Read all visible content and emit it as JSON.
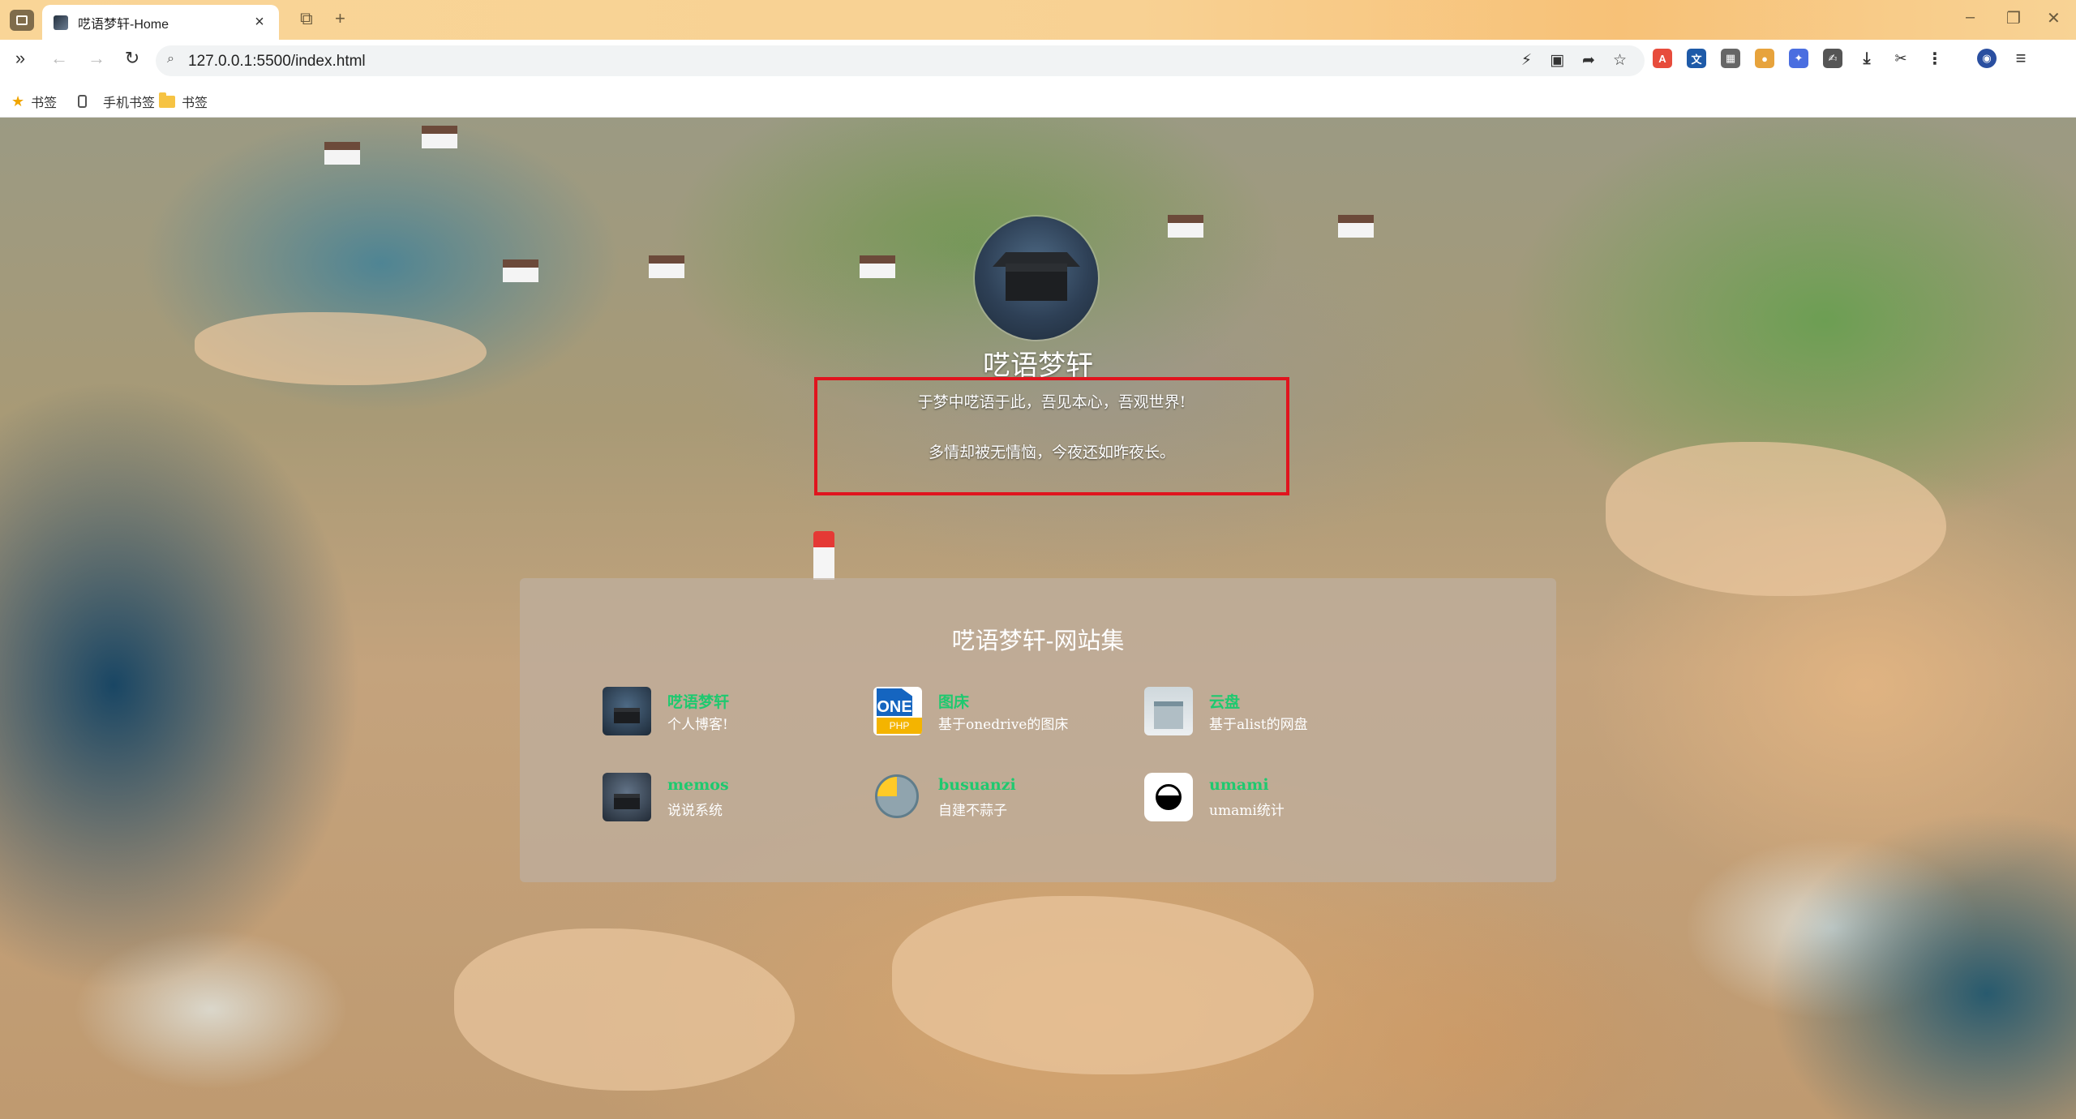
{
  "browser": {
    "tab_title": "呓语梦轩-Home",
    "url": "127.0.0.1:5500/index.html",
    "bookmarks": [
      {
        "label": "书签",
        "icon": "star-icon"
      },
      {
        "label": "手机书签",
        "icon": "phone-icon"
      },
      {
        "label": "书签",
        "icon": "folder-icon"
      }
    ]
  },
  "header": {
    "site_title": "呓语梦轩",
    "motto_line1": "于梦中呓语于此，吾见本心，吾观世界!",
    "motto_line2": "多情却被无情恼，今夜还如昨夜长。"
  },
  "sites": {
    "title": "呓语梦轩-网站集",
    "items": [
      {
        "name": "呓语梦轩",
        "desc": "个人博客!",
        "icon": "blog-icon"
      },
      {
        "name": "图床",
        "desc": "基于onedrive的图床",
        "icon": "onedrive-icon"
      },
      {
        "name": "云盘",
        "desc": "基于alist的网盘",
        "icon": "cloud-icon"
      },
      {
        "name": "memos",
        "desc": "说说系统",
        "icon": "memos-icon"
      },
      {
        "name": "busuanzi",
        "desc": "自建不蒜子",
        "icon": "busuanzi-icon"
      },
      {
        "name": "umami",
        "desc": "umami统计",
        "icon": "umami-icon"
      }
    ]
  },
  "colors": {
    "link": "#1ec96f",
    "highlight": "#e0141e"
  }
}
